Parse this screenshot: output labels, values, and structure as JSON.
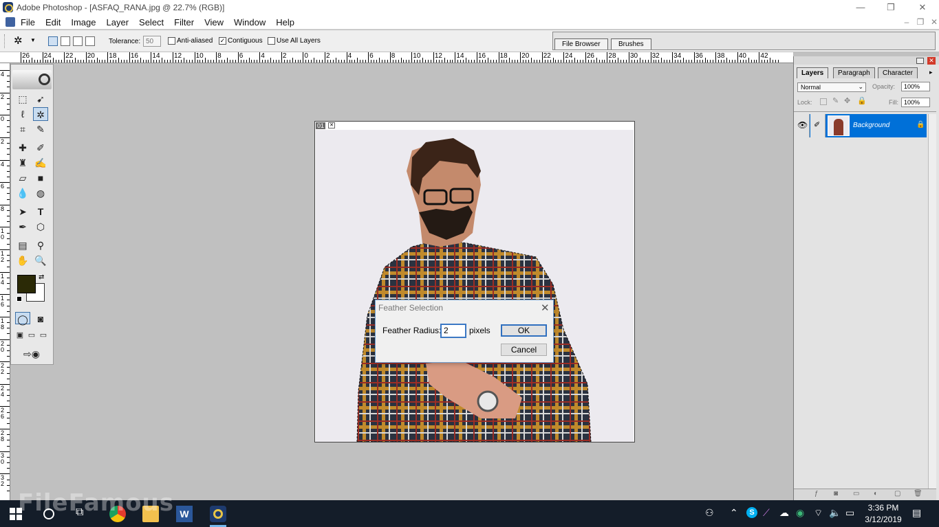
{
  "window": {
    "title": "Adobe Photoshop - [ASFAQ_RANA.jpg @ 22.7% (RGB)]",
    "minimize": "—",
    "restore": "❐",
    "close": "✕"
  },
  "menu": {
    "items": [
      "File",
      "Edit",
      "Image",
      "Layer",
      "Select",
      "Filter",
      "View",
      "Window",
      "Help"
    ],
    "doc_minimize": "–",
    "doc_restore": "❐",
    "doc_close": "✕"
  },
  "options": {
    "tolerance_label": "Tolerance:",
    "tolerance_value": "50",
    "anti_aliased_label": "Anti-aliased",
    "anti_aliased_checked": false,
    "contiguous_label": "Contiguous",
    "contiguous_checked": true,
    "use_all_layers_label": "Use All Layers",
    "use_all_layers_checked": false,
    "tabs": [
      "File Browser",
      "Brushes"
    ]
  },
  "ruler": {
    "h_labels": [
      "26",
      "24",
      "22",
      "20",
      "18",
      "16",
      "14",
      "12",
      "10",
      "8",
      "6",
      "4",
      "2",
      "0",
      "2",
      "4",
      "6",
      "8",
      "10",
      "12",
      "14",
      "16",
      "18",
      "20",
      "22",
      "24",
      "26",
      "28",
      "30",
      "32",
      "34",
      "36",
      "38",
      "40",
      "42"
    ],
    "v_labels": [
      "4",
      "2",
      "0",
      "2",
      "4",
      "6",
      "8",
      "10",
      "12",
      "14",
      "16",
      "18",
      "20",
      "22",
      "24",
      "26",
      "28",
      "30",
      "32"
    ]
  },
  "document": {
    "number": "01",
    "colors": {
      "foreground": "#2b2a06",
      "background": "#ffffff"
    }
  },
  "dialog": {
    "title": "Feather Selection",
    "radius_label": "Feather Radius:",
    "radius_value": "2",
    "units": "pixels",
    "ok_label": "OK",
    "cancel_label": "Cancel"
  },
  "layers_panel": {
    "tabs": [
      "Layers",
      "Paragraph",
      "Character"
    ],
    "active_tab": "Layers",
    "blend_mode": "Normal",
    "opacity_label": "Opacity:",
    "opacity_value": "100%",
    "lock_label": "Lock:",
    "fill_label": "Fill:",
    "fill_value": "100%",
    "layers": [
      {
        "name": "Background",
        "visible": true,
        "locked": true,
        "selected": true
      }
    ]
  },
  "taskbar": {
    "time": "3:36 PM",
    "date": "3/12/2019",
    "watermark": "FileFamous"
  }
}
